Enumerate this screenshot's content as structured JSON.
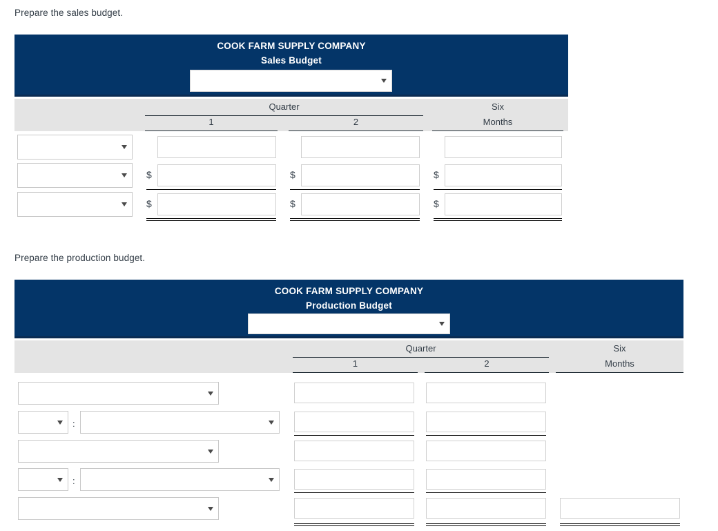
{
  "prompts": {
    "sales": "Prepare the sales budget.",
    "production": "Prepare the production budget."
  },
  "colors": {
    "header_navy": "#043568",
    "header_band_gray": "#e4e4e4",
    "text_dark": "#323c46",
    "input_border": "#cfcfcf"
  },
  "sales_budget": {
    "company": "COOK FARM SUPPLY COMPANY",
    "title": "Sales Budget",
    "period_select": {
      "value": "",
      "placeholder": ""
    },
    "columns": {
      "group_label": "Quarter",
      "q1": "1",
      "q2": "2",
      "six_months_line1": "Six",
      "six_months_line2": "Months"
    },
    "currency_symbol": "$",
    "rows": [
      {
        "label_select": {
          "value": ""
        },
        "q1": {
          "value": "",
          "currency": false
        },
        "q2": {
          "value": "",
          "currency": false
        },
        "six_months": {
          "value": "",
          "currency": false
        },
        "underline": "none"
      },
      {
        "label_select": {
          "value": ""
        },
        "q1": {
          "value": "",
          "currency": true
        },
        "q2": {
          "value": "",
          "currency": true
        },
        "six_months": {
          "value": "",
          "currency": true
        },
        "underline": "single"
      },
      {
        "label_select": {
          "value": ""
        },
        "q1": {
          "value": "",
          "currency": true
        },
        "q2": {
          "value": "",
          "currency": true
        },
        "six_months": {
          "value": "",
          "currency": true
        },
        "underline": "double"
      }
    ]
  },
  "production_budget": {
    "company": "COOK FARM SUPPLY COMPANY",
    "title": "Production Budget",
    "period_select": {
      "value": "",
      "placeholder": ""
    },
    "columns": {
      "group_label": "Quarter",
      "q1": "1",
      "q2": "2",
      "six_months_line1": "Six",
      "six_months_line2": "Months"
    },
    "separator": ":",
    "rows": [
      {
        "type": "single",
        "label_select": {
          "value": ""
        },
        "q1": {
          "value": ""
        },
        "q2": {
          "value": ""
        },
        "six_months": null,
        "underline": "none"
      },
      {
        "type": "pair",
        "prefix_select": {
          "value": ""
        },
        "label_select": {
          "value": ""
        },
        "q1": {
          "value": ""
        },
        "q2": {
          "value": ""
        },
        "six_months": null,
        "underline": "single"
      },
      {
        "type": "single",
        "label_select": {
          "value": ""
        },
        "q1": {
          "value": ""
        },
        "q2": {
          "value": ""
        },
        "six_months": null,
        "underline": "none"
      },
      {
        "type": "pair",
        "prefix_select": {
          "value": ""
        },
        "label_select": {
          "value": ""
        },
        "q1": {
          "value": ""
        },
        "q2": {
          "value": ""
        },
        "six_months": null,
        "underline": "single"
      },
      {
        "type": "single",
        "label_select": {
          "value": ""
        },
        "q1": {
          "value": ""
        },
        "q2": {
          "value": ""
        },
        "six_months": {
          "value": ""
        },
        "underline": "double"
      }
    ]
  }
}
